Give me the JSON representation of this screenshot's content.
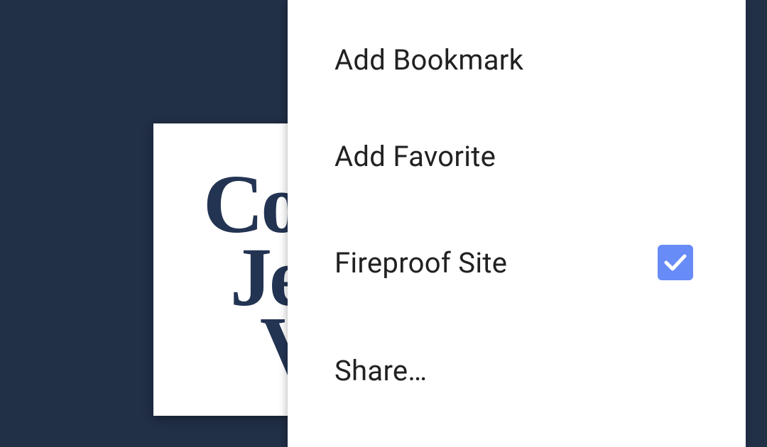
{
  "background": {
    "color": "#212f47",
    "logo_lines": [
      "Co",
      "Je",
      "V"
    ],
    "logo_color": "#233453"
  },
  "menu": {
    "items": [
      {
        "label": "Add Bookmark"
      },
      {
        "label": "Add Favorite"
      },
      {
        "label": "Fireproof Site",
        "checked": true,
        "check_icon": "checkmark-icon"
      },
      {
        "label": "Share…"
      }
    ],
    "accent_color": "#678bf7"
  }
}
